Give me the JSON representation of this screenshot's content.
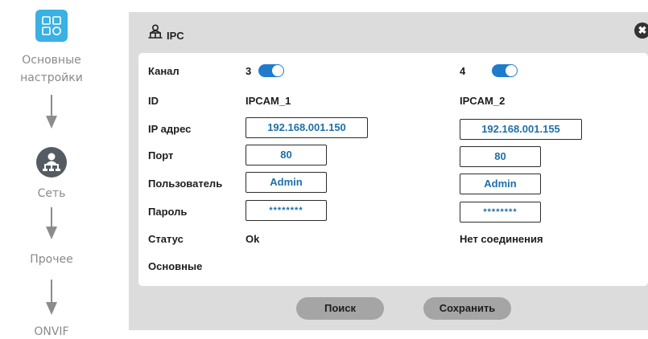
{
  "wizard": {
    "steps": [
      {
        "label1": "Основные",
        "label2": "настройки",
        "icon": "settings-grid-icon",
        "accent": "#3ab0e3"
      },
      {
        "label": "Сеть",
        "icon": "network-icon"
      },
      {
        "label": "Прочее"
      },
      {
        "label": "ONVIF"
      }
    ]
  },
  "dialog": {
    "title": "IPC",
    "icon": "ipc-network-icon",
    "close_glyph": "✖",
    "labels": {
      "channel": "Канал",
      "id": "ID",
      "ip": "IP адрес",
      "port": "Порт",
      "user": "Пользователь",
      "password": "Пароль",
      "status": "Статус",
      "main": "Основные"
    },
    "channels": [
      {
        "number": "3",
        "enabled": true,
        "id": "IPCAM_1",
        "ip": "192.168.001.150",
        "port": "80",
        "user": "Admin",
        "password": "********",
        "status": "Ok"
      },
      {
        "number": "4",
        "enabled": true,
        "id": "IPCAM_2",
        "ip": "192.168.001.155",
        "port": "80",
        "user": "Admin",
        "password": "********",
        "status": "Нет соединения"
      }
    ],
    "buttons": {
      "search": "Поиск",
      "save": "Сохранить"
    }
  },
  "colors": {
    "toggle_on": "#1f7ccd",
    "field_text": "#1e6fa8",
    "panel_bg": "#dcdcdc"
  }
}
